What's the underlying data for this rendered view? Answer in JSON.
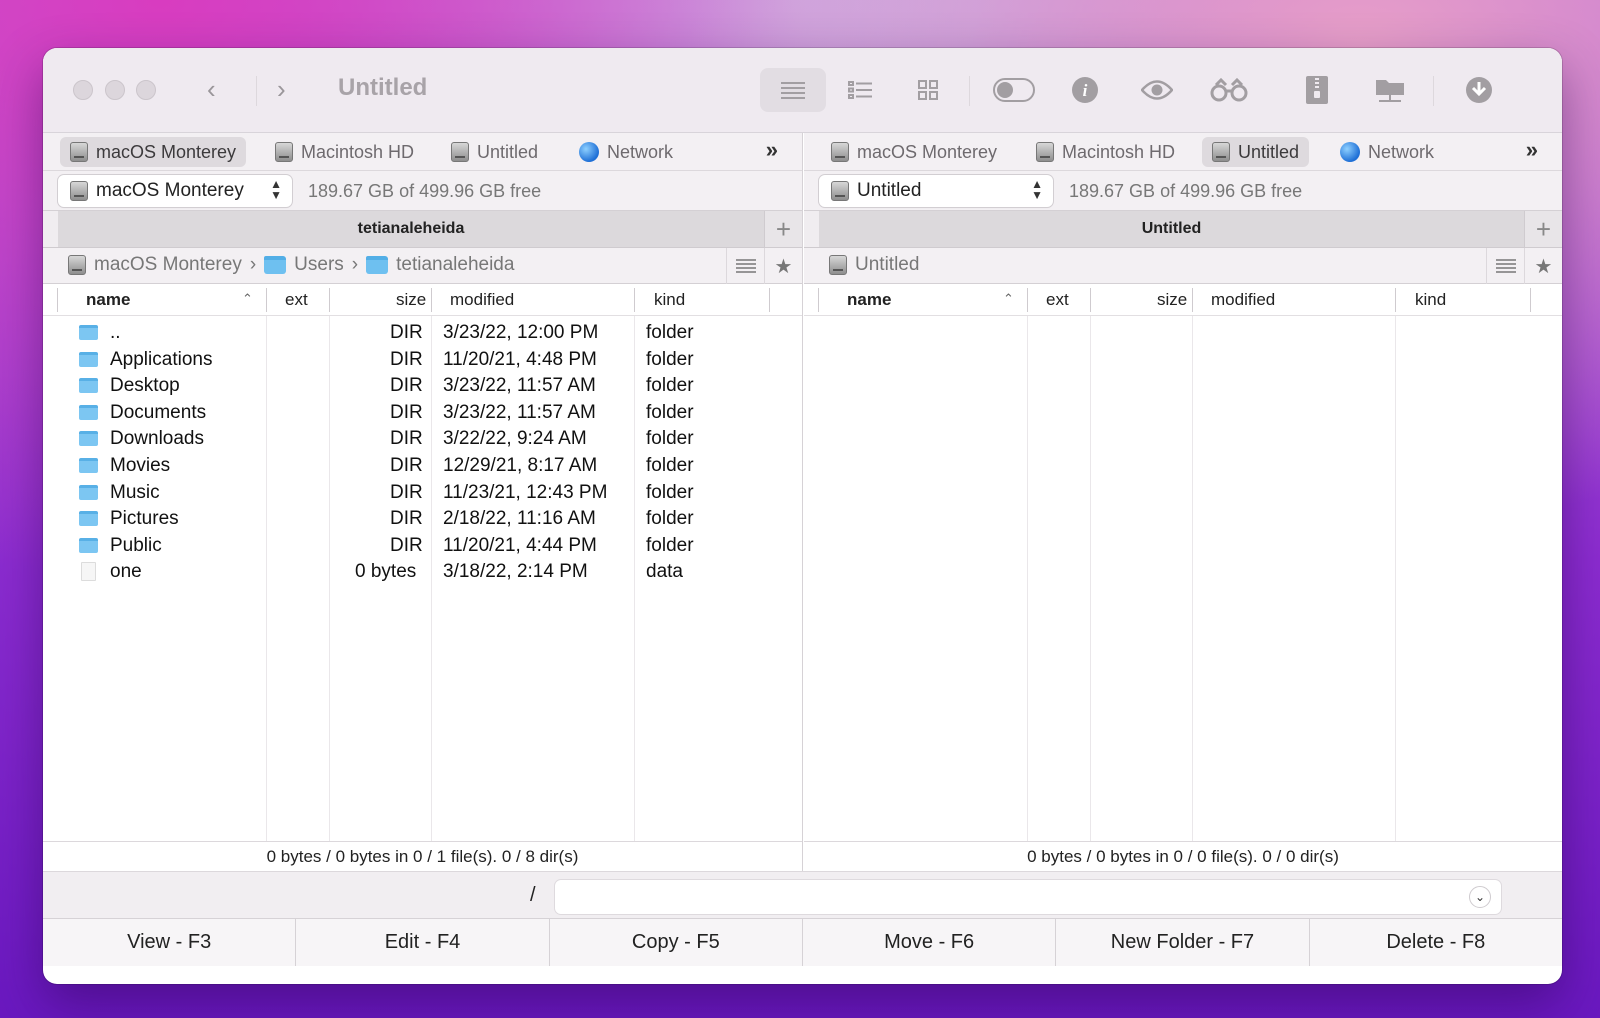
{
  "window": {
    "title": "Untitled"
  },
  "toolbar": {
    "icons": [
      "list-view-icon",
      "detail-view-icon",
      "grid-view-icon",
      "toggle-hidden-icon",
      "info-icon",
      "quick-look-icon",
      "search-binoculars-icon",
      "archive-icon",
      "network-connect-icon",
      "download-icon"
    ]
  },
  "left": {
    "tabs": [
      "macOS Monterey",
      "Macintosh HD",
      "Untitled",
      "Network"
    ],
    "more": "»",
    "volume": "macOS Monterey",
    "free": "189.67 GB of 499.96 GB free",
    "path_tab": "tetianaleheida",
    "add_tab": "+",
    "crumbs": [
      "macOS Monterey",
      "Users",
      "tetianaleheida"
    ],
    "crumb_sep": "›",
    "columns": {
      "name": "name",
      "ext": "ext",
      "size": "size",
      "modified": "modified",
      "kind": "kind"
    },
    "rows": [
      {
        "name": "..",
        "size": "DIR",
        "modified": "3/23/22, 12:00 PM",
        "kind": "folder"
      },
      {
        "name": "Applications",
        "size": "DIR",
        "modified": "11/20/21, 4:48 PM",
        "kind": "folder"
      },
      {
        "name": "Desktop",
        "size": "DIR",
        "modified": "3/23/22, 11:57 AM",
        "kind": "folder"
      },
      {
        "name": "Documents",
        "size": "DIR",
        "modified": "3/23/22, 11:57 AM",
        "kind": "folder"
      },
      {
        "name": "Downloads",
        "size": "DIR",
        "modified": "3/22/22, 9:24 AM",
        "kind": "folder"
      },
      {
        "name": "Movies",
        "size": "DIR",
        "modified": "12/29/21, 8:17 AM",
        "kind": "folder"
      },
      {
        "name": "Music",
        "size": "DIR",
        "modified": "11/23/21, 12:43 PM",
        "kind": "folder"
      },
      {
        "name": "Pictures",
        "size": "DIR",
        "modified": "2/18/22, 11:16 AM",
        "kind": "folder"
      },
      {
        "name": "Public",
        "size": "DIR",
        "modified": "11/20/21, 4:44 PM",
        "kind": "folder"
      },
      {
        "name": "one",
        "size": "0 bytes",
        "modified": "3/18/22, 2:14 PM",
        "kind": "data"
      }
    ],
    "status": "0 bytes / 0 bytes in 0 / 1 file(s). 0 / 8 dir(s)"
  },
  "right": {
    "tabs": [
      "macOS Monterey",
      "Macintosh HD",
      "Untitled",
      "Network"
    ],
    "more": "»",
    "volume": "Untitled",
    "free": "189.67 GB of 499.96 GB free",
    "path_tab": "Untitled",
    "add_tab": "+",
    "crumbs": [
      "Untitled"
    ],
    "columns": {
      "name": "name",
      "ext": "ext",
      "size": "size",
      "modified": "modified",
      "kind": "kind"
    },
    "status": "0 bytes / 0 bytes in 0 / 0 file(s). 0 / 0 dir(s)"
  },
  "command": {
    "prompt": "/",
    "value": ""
  },
  "fkeys": [
    "View - F3",
    "Edit - F4",
    "Copy - F5",
    "Move - F6",
    "New Folder - F7",
    "Delete - F8"
  ]
}
